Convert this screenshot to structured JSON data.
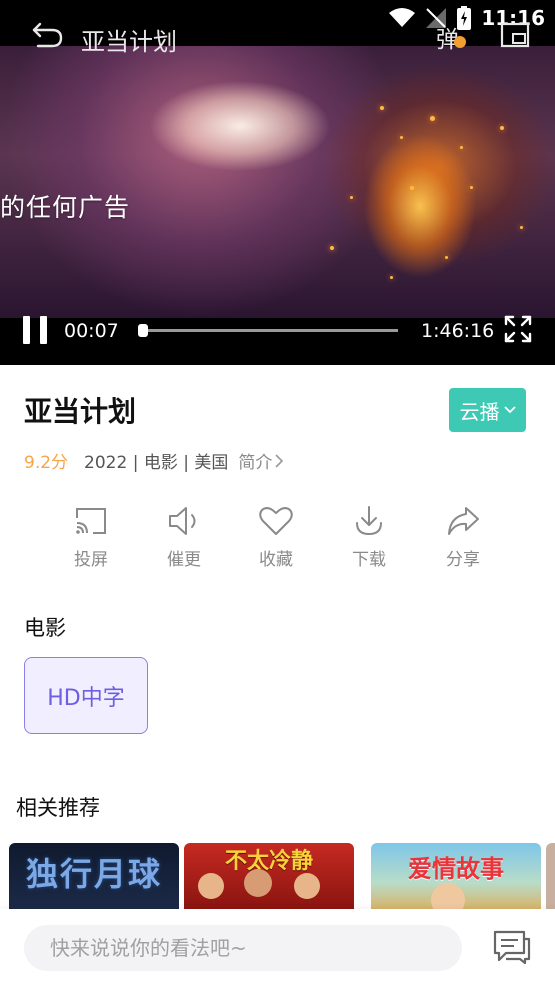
{
  "status": {
    "time": "11:16"
  },
  "player": {
    "title": "亚当计划",
    "overlay_text": "的任何广告",
    "danmu_label": "弹",
    "current_time": "00:07",
    "total_time": "1:46:16",
    "progress": 0.001
  },
  "detail": {
    "title": "亚当计划",
    "source_label": "云播",
    "rating": "9.2分",
    "info": "2022 | 电影 | 美国",
    "intro_label": "简介"
  },
  "actions": [
    {
      "label": "投屏",
      "icon": "cast-icon"
    },
    {
      "label": "催更",
      "icon": "speaker-icon"
    },
    {
      "label": "收藏",
      "icon": "heart-icon"
    },
    {
      "label": "下载",
      "icon": "download-icon"
    },
    {
      "label": "分享",
      "icon": "share-icon"
    }
  ],
  "episodes": {
    "section_title": "电影",
    "items": [
      {
        "label": "HD中字"
      }
    ]
  },
  "recommend": {
    "section_title": "相关推荐",
    "items": [
      {
        "title": "独行月球"
      },
      {
        "title": "不太冷静"
      },
      {
        "title": "爱情故事"
      }
    ]
  },
  "comment": {
    "placeholder": "快来说说你的看法吧~"
  },
  "colors": {
    "accent_teal": "#3ec9b4",
    "rating_orange": "#f5a54a",
    "episode_purple": "#6d5fe0"
  }
}
